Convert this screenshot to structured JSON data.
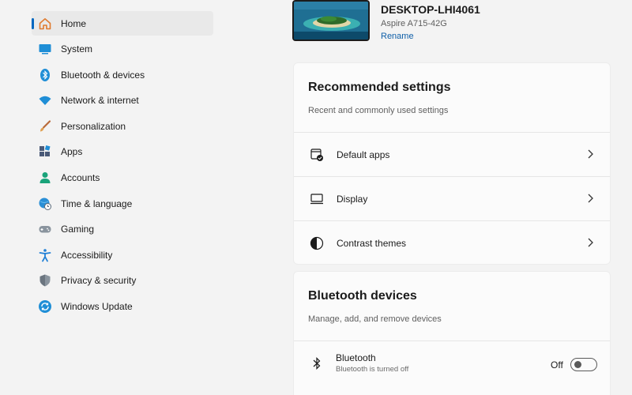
{
  "sidebar": {
    "items": [
      {
        "label": "Home",
        "icon": "home-icon",
        "selected": true
      },
      {
        "label": "System",
        "icon": "system-icon"
      },
      {
        "label": "Bluetooth & devices",
        "icon": "bluetooth-icon"
      },
      {
        "label": "Network & internet",
        "icon": "wifi-icon"
      },
      {
        "label": "Personalization",
        "icon": "brush-icon"
      },
      {
        "label": "Apps",
        "icon": "apps-icon"
      },
      {
        "label": "Accounts",
        "icon": "accounts-icon"
      },
      {
        "label": "Time & language",
        "icon": "globe-clock-icon"
      },
      {
        "label": "Gaming",
        "icon": "gamepad-icon"
      },
      {
        "label": "Accessibility",
        "icon": "accessibility-icon"
      },
      {
        "label": "Privacy & security",
        "icon": "shield-icon"
      },
      {
        "label": "Windows Update",
        "icon": "update-icon"
      }
    ]
  },
  "device": {
    "name": "DESKTOP-LHI4061",
    "model": "Aspire A715-42G",
    "rename_label": "Rename"
  },
  "recommended": {
    "title": "Recommended settings",
    "subtitle": "Recent and commonly used settings",
    "rows": [
      {
        "label": "Default apps",
        "icon": "default-apps-icon"
      },
      {
        "label": "Display",
        "icon": "display-icon"
      },
      {
        "label": "Contrast themes",
        "icon": "contrast-icon"
      }
    ]
  },
  "bluetooth": {
    "title": "Bluetooth devices",
    "subtitle": "Manage, add, and remove devices",
    "row": {
      "name": "Bluetooth",
      "status": "Bluetooth is turned off",
      "toggle_label": "Off",
      "toggle_on": false,
      "icon": "bluetooth-icon"
    }
  },
  "colors": {
    "accent": "#0067c0",
    "background": "#f3f3f3",
    "card": "#fbfbfb"
  }
}
